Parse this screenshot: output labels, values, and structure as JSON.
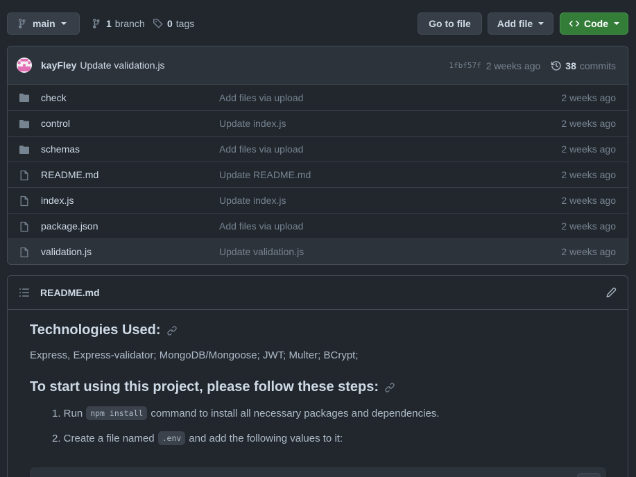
{
  "toolbar": {
    "branch_label": "main",
    "branches_count": "1",
    "branches_label": "branch",
    "tags_count": "0",
    "tags_label": "tags",
    "goto_label": "Go to file",
    "addfile_label": "Add file",
    "code_label": "Code"
  },
  "commit": {
    "author": "kayFley",
    "message": "Update validation.js",
    "sha": "1fbf57f",
    "time": "2 weeks ago",
    "commits_count": "38",
    "commits_label": "commits"
  },
  "files": [
    {
      "type": "folder",
      "name": "check",
      "message": "Add files via upload",
      "time": "2 weeks ago"
    },
    {
      "type": "folder",
      "name": "control",
      "message": "Update index.js",
      "time": "2 weeks ago"
    },
    {
      "type": "folder",
      "name": "schemas",
      "message": "Add files via upload",
      "time": "2 weeks ago"
    },
    {
      "type": "file",
      "name": "README.md",
      "message": "Update README.md",
      "time": "2 weeks ago"
    },
    {
      "type": "file",
      "name": "index.js",
      "message": "Update index.js",
      "time": "2 weeks ago"
    },
    {
      "type": "file",
      "name": "package.json",
      "message": "Add files via upload",
      "time": "2 weeks ago"
    },
    {
      "type": "file",
      "name": "validation.js",
      "message": "Update validation.js",
      "time": "2 weeks ago"
    }
  ],
  "readme": {
    "title": "README.md",
    "heading1": "Technologies Used:",
    "tech_list": "Express, Express-validator; MongoDB/Mongoose; JWT; Multer; BCrypt;",
    "heading2": "To start using this project, please follow these steps:",
    "step1_prefix": "1. Run",
    "step1_code": "npm install",
    "step1_suffix": "command to install all necessary packages and dependencies.",
    "step2_prefix": "2. Create a file named",
    "step2_code": ".env",
    "step2_suffix": "and add the following values to it:"
  },
  "colors": {
    "background": "#22272e",
    "code_button": "#347d39",
    "folder_icon": "#768390"
  }
}
